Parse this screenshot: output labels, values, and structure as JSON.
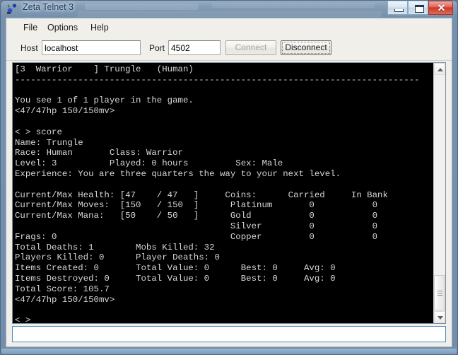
{
  "window": {
    "title": "Zeta Telnet 3",
    "icon": "app-icon",
    "buttons": {
      "minimize": "minimize-icon",
      "maximize": "maximize-icon",
      "close": "✕"
    }
  },
  "menubar": {
    "items": [
      {
        "label": "File"
      },
      {
        "label": "Options"
      },
      {
        "label": "Help"
      }
    ]
  },
  "connection": {
    "host_label": "Host",
    "host_value": "localhost",
    "host_placeholder": "",
    "port_label": "Port",
    "port_value": "4502",
    "port_placeholder": "",
    "connect_label": "Connect",
    "connect_enabled": "false",
    "disconnect_label": "Disconnect",
    "disconnect_enabled": "true"
  },
  "terminal": {
    "foreground": "#d7d7d7",
    "background": "#000000",
    "text": "[3  Warrior    ] Trungle   (Human)\n-----------------------------------------------------------------------------\n\nYou see 1 of 1 player in the game.\n<47/47hp 150/150mv>\n\n< > score\nName: Trungle\nRace: Human       Class: Warrior\nLevel: 3          Played: 0 hours         Sex: Male\nExperience: You are three quarters the way to your next level.\n\nCurrent/Max Health: [47    / 47   ]     Coins:      Carried     In Bank\nCurrent/Max Moves:  [150   / 150  ]      Platinum       0           0\nCurrent/Max Mana:   [50    / 50   ]      Gold           0           0\n                                         Silver         0           0\nFrags: 0                                 Copper         0           0\nTotal Deaths: 1        Mobs Killed: 32\nPlayers Killed: 0      Player Deaths: 0\nItems Created: 0       Total Value: 0      Best: 0     Avg: 0\nItems Destroyed: 0     Total Value: 0      Best: 0     Avg: 0\nTotal Score: 105.7\n<47/47hp 150/150mv>\n\n< >",
    "scrollbar": {
      "up_arrow": "scroll-up-icon",
      "down_arrow": "scroll-down-icon"
    }
  },
  "command": {
    "value": "",
    "placeholder": ""
  },
  "game_stats": {
    "status_line": "[3  Warrior    ] Trungle   (Human)",
    "name": "Trungle",
    "race": "Human",
    "class": "Warrior",
    "level": "3",
    "played": "0 hours",
    "sex": "Male",
    "experience": "You are three quarters the way to your next level.",
    "health_current": "47",
    "health_max": "47",
    "moves_current": "150",
    "moves_max": "150",
    "mana_current": "50",
    "mana_max": "50",
    "coins": [
      {
        "type": "Platinum",
        "carried": "0",
        "in_bank": "0"
      },
      {
        "type": "Gold",
        "carried": "0",
        "in_bank": "0"
      },
      {
        "type": "Silver",
        "carried": "0",
        "in_bank": "0"
      },
      {
        "type": "Copper",
        "carried": "0",
        "in_bank": "0"
      }
    ],
    "frags": "0",
    "total_deaths": "1",
    "mobs_killed": "32",
    "players_killed": "0",
    "player_deaths": "0",
    "items_created": "0",
    "items_created_total_value": "0",
    "items_created_best": "0",
    "items_created_avg": "0",
    "items_destroyed": "0",
    "items_destroyed_total_value": "0",
    "items_destroyed_best": "0",
    "items_destroyed_avg": "0",
    "total_score": "105.7",
    "prompt": "<47/47hp 150/150mv>",
    "players_online": "You see 1 of 1 player in the game."
  }
}
